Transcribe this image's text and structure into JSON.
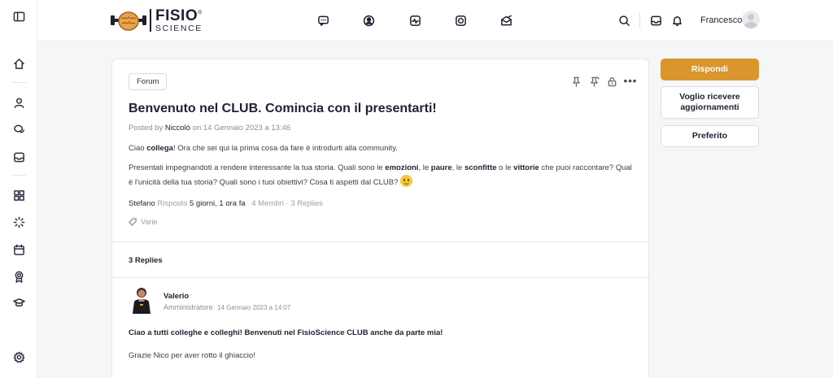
{
  "header": {
    "logo": {
      "word1": "FISIO",
      "word2": "SCIENCE",
      "registered": "®"
    },
    "nav_icons": [
      "chat-icon",
      "user-circle-icon",
      "activity-icon",
      "camera-icon",
      "mail-open-icon"
    ],
    "username": "Francesco"
  },
  "rail_icons": [
    "sidebar-toggle-icon",
    "home-icon",
    "user-icon",
    "chat-bubbles-icon",
    "inbox-icon",
    "apps-grid-icon",
    "loader-icon",
    "calendar-icon",
    "award-icon",
    "graduation-cap-icon",
    "settings-icon"
  ],
  "topic": {
    "forum_label": "Forum",
    "title": "Benvenuto nel CLUB. Comincia con il presentarti!",
    "posted_by_prefix": "Posted by",
    "posted_by_author": "Niccolò",
    "posted_on": "on 14 Gennaio 2023 a 13:46",
    "p1_a": "Ciao ",
    "p1_b": "collega",
    "p1_c": "! Ora che sei qui la prima cosa da fare è introdurti alla community.",
    "p2_a": "Presentati impegnandoti a rendere interessante la tua storia. Quali sono le ",
    "p2_b": "emozioni",
    "p2_c": ", le ",
    "p2_d": "paure",
    "p2_e": ", le ",
    "p2_f": "sconfitte",
    "p2_g": " o le ",
    "p2_h": "vittorie",
    "p2_i": " che puoi raccontare? Qual è l'unicità della tua storia? Quali sono i tuoi obiettivi? Cosa ti aspetti dal CLUB?",
    "last_reply_user": "Stefano",
    "last_reply_label": "Risposto",
    "last_reply_time": "5 giorni, 1 ora fa",
    "stats": "4 Membri · 3 Replies",
    "tag": "Varie"
  },
  "replies": {
    "count_label": "3 Replies",
    "first": {
      "name": "Valerio",
      "role": "Amministratore",
      "date": "14 Gennaio 2023 a 14:07",
      "text1": "Ciao a tutti colleghe e colleghi! Benvenuti nel FisioScience CLUB anche da parte mia!",
      "text2": "Grazie Nico per aver rotto il ghiaccio!"
    }
  },
  "sidebar_actions": {
    "reply": "Rispondi",
    "subscribe": "Voglio ricevere aggiornamenti",
    "favorite": "Preferito"
  },
  "colors": {
    "accent": "#d9962f",
    "text": "#1e2132",
    "muted": "#8a8e98"
  }
}
